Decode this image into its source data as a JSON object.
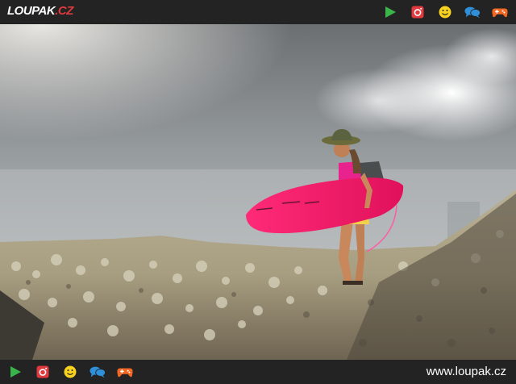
{
  "brand": {
    "name": "LOUPAK",
    "tld": ".CZ"
  },
  "header": {
    "icons": [
      "play-icon",
      "instagram-icon",
      "smiley-icon",
      "chat-icon",
      "gamepad-icon"
    ]
  },
  "footer": {
    "icons": [
      "play-icon",
      "instagram-icon",
      "smiley-icon",
      "chat-icon",
      "gamepad-icon"
    ],
    "site_url": "www.loupak.cz"
  },
  "colors": {
    "bar_bg": "#232323",
    "play": "#3ab54a",
    "instagram": "#e03a3e",
    "smiley": "#f7d21e",
    "chat": "#2f8fd8",
    "gamepad": "#f26722",
    "brand_accent": "#e03a3e"
  }
}
